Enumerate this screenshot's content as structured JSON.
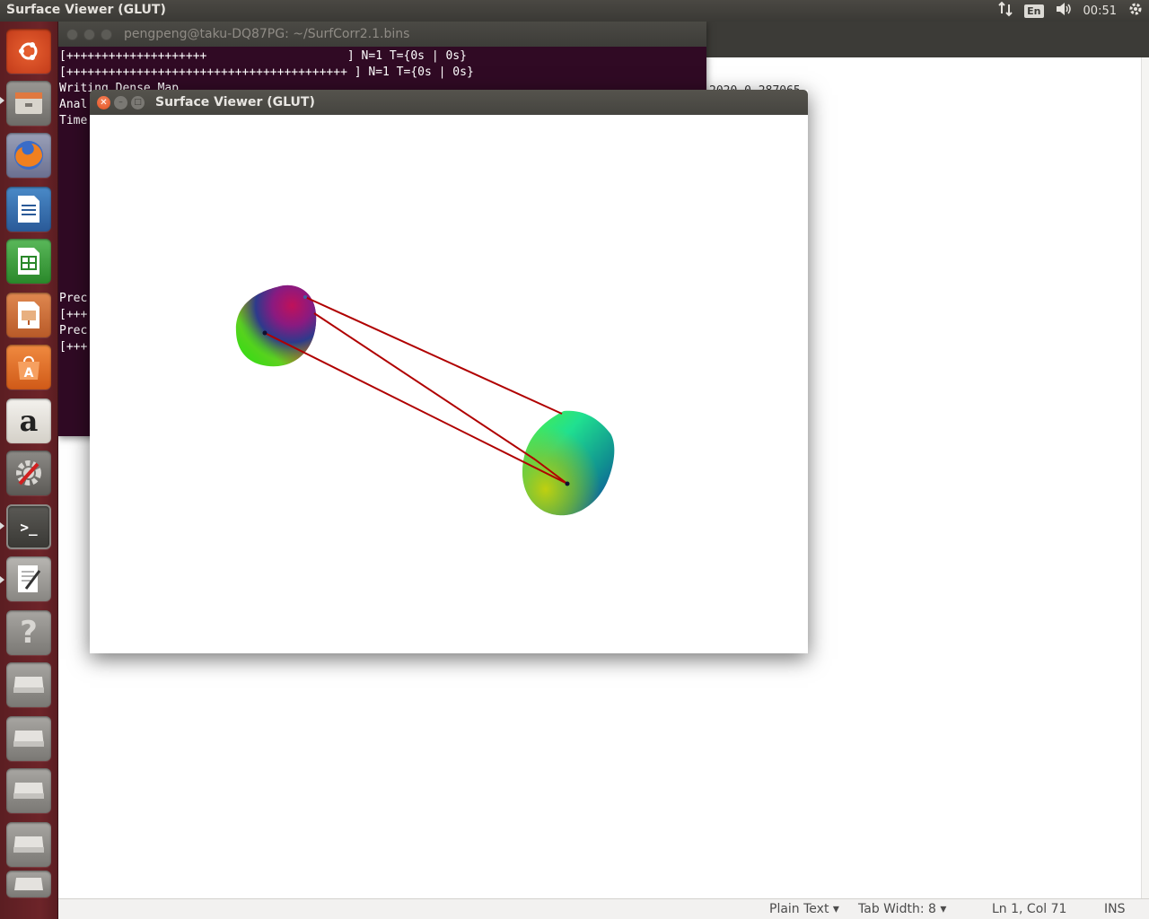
{
  "top_panel": {
    "app_title": "Surface Viewer (GLUT)",
    "keyboard_layout": "En",
    "clock": "00:51"
  },
  "editor": {
    "partial_text": "2020  0.287065",
    "status": {
      "language": "Plain Text ▾",
      "tab_width": "Tab Width: 8 ▾",
      "cursor": "Ln 1, Col 71",
      "mode": "INS"
    }
  },
  "terminal": {
    "title": "pengpeng@taku-DQ87PG: ~/SurfCorr2.1.bins",
    "lines": [
      "[++++++++++++++++++++                    ] N=1 T={0s | 0s}",
      "[++++++++++++++++++++++++++++++++++++++++ ] N=1 T={0s | 0s}",
      "Writing Dense Map",
      "Anal",
      "Time",
      "",
      "",
      "",
      "",
      "",
      "",
      "",
      "",
      "",
      "",
      "Prec",
      "[+++",
      "Prec",
      "[+++"
    ]
  },
  "viewer": {
    "title": "Surface Viewer (GLUT)"
  },
  "launcher": {
    "items": [
      {
        "name": "ubuntu-logo-icon"
      },
      {
        "name": "files-icon"
      },
      {
        "name": "firefox-icon"
      },
      {
        "name": "writer-icon"
      },
      {
        "name": "calc-icon"
      },
      {
        "name": "impress-icon"
      },
      {
        "name": "software-center-icon"
      },
      {
        "name": "amazon-icon",
        "glyph": "a"
      },
      {
        "name": "system-settings-icon"
      },
      {
        "name": "terminal-icon",
        "glyph": ">_"
      },
      {
        "name": "text-editor-icon"
      },
      {
        "name": "help-icon",
        "glyph": "?"
      },
      {
        "name": "drive-icon"
      },
      {
        "name": "drive-icon"
      },
      {
        "name": "drive-icon"
      },
      {
        "name": "drive-icon"
      },
      {
        "name": "trash-icon"
      }
    ]
  },
  "colors": {
    "launcher": "#6d2429",
    "terminal_bg": "#300a24",
    "correspondence_line": "#b00000",
    "close_button": "#e2501f"
  }
}
